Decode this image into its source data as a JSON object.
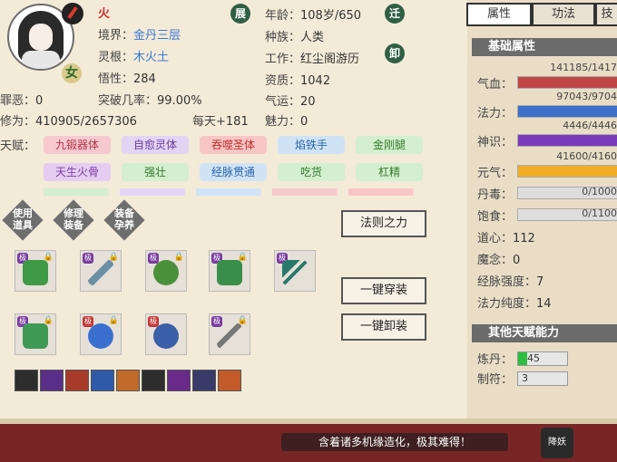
{
  "header": {
    "element": "火",
    "gender": "女",
    "realm_label": "境界：",
    "realm_value": "金丹三层",
    "root_label": "灵根：",
    "root_value": "木火土",
    "wisdom_label": "悟性：",
    "wisdom_value": "284",
    "breakthrough_label": "突破几率：",
    "breakthrough_value": "99.00%",
    "sin_label": "罪恶：",
    "sin_value": "0",
    "cultivation_label": "修为：",
    "cultivation_value": "410905/2657306",
    "daily_label": "每天+",
    "daily_value": "181",
    "age_label": "年龄：",
    "age_value": "108岁/650",
    "race_label": "种族：",
    "race_value": "人类",
    "job_label": "工作：",
    "job_value": "红尘阁游历",
    "talent_label": "资质：",
    "talent_value": "1042",
    "luck_label": "气运：",
    "luck_value": "20",
    "charm_label": "魅力：",
    "charm_value": "0",
    "seal_expand": "展",
    "seal_move": "迁",
    "seal_unload": "卸"
  },
  "talents": {
    "label": "天赋：",
    "row1": [
      "九锻器体",
      "自愈灵体",
      "吞噬圣体",
      "焰铁手",
      "金刚腿"
    ],
    "row2": [
      "天生火骨",
      "强壮",
      "经脉贯通",
      "吃货",
      "杠精"
    ]
  },
  "actions": {
    "use_item": [
      "使用",
      "道具"
    ],
    "repair": [
      "修理",
      "装备"
    ],
    "equip_nurture": [
      "装备",
      "孕养"
    ],
    "law_power": "法则之力",
    "one_key_equip": "一键穿装",
    "one_key_unequip": "一键卸装"
  },
  "equipment": {
    "mark_label": "极"
  },
  "tabs": [
    "属性",
    "功法",
    "技"
  ],
  "basic_attrs": {
    "title": "基础属性",
    "qixue_label": "气血：",
    "qixue_value": "141185/1417",
    "fali_label": "法力：",
    "fali_value": "97043/9704",
    "shenshi_label": "神识：",
    "shenshi_value": "4446/4446",
    "yuanqi_label": "元气：",
    "yuanqi_value": "41600/4160",
    "dandu_label": "丹毒：",
    "dandu_value": "0/1000",
    "baoshi_label": "饱食：",
    "baoshi_value": "0/1100",
    "daoxin_label": "道心：",
    "daoxin_value": "112",
    "monian_label": "魔念：",
    "monian_value": "0",
    "jingmai_label": "经脉强度：",
    "jingmai_value": "7",
    "falichun_label": "法力纯度：",
    "falichun_value": "14"
  },
  "bar_levels": {
    "qixue": 0.996,
    "fali": 1.0,
    "shenshi": 1.0,
    "yuanqi": 1.0,
    "dandu": 0,
    "baoshi": 0
  },
  "colors": {
    "qixue": "#c04646",
    "fali": "#3d6fc8",
    "shenshi": "#7b3bbd",
    "yuanqi": "#f0ae2a"
  },
  "other_talents": {
    "title": "其他天赋能力",
    "liandan_label": "炼丹：",
    "liandan_value": "45",
    "zhifu_label": "制符：",
    "zhifu_value": "3"
  },
  "bottom": {
    "tip": "含着诸多机缘造化，极其难得！",
    "brand": "降妖"
  }
}
